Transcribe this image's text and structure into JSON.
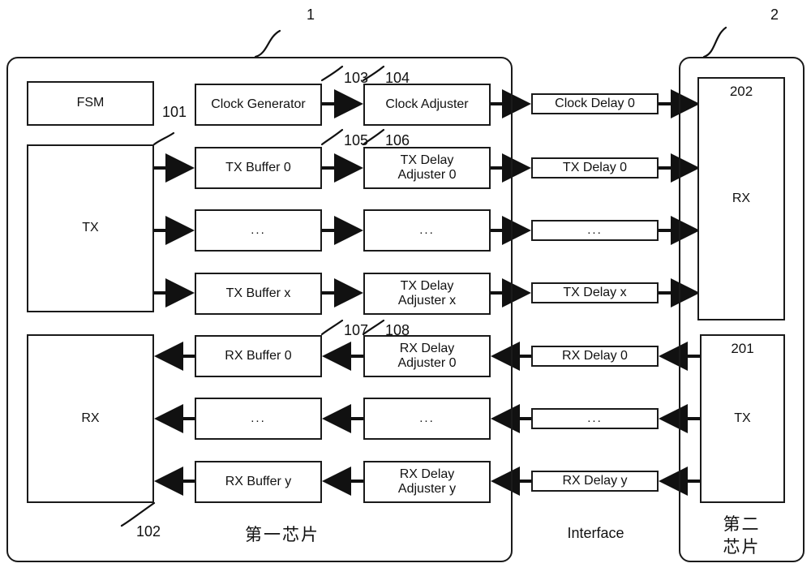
{
  "figure": {
    "refs": {
      "chip1": "1",
      "chip2": "2",
      "tx_core": "101",
      "rx_core": "102",
      "clock_generator": "103",
      "clock_adjuster": "104",
      "tx_buffer": "105",
      "tx_delay_adjuster": "106",
      "rx_buffer": "107",
      "rx_delay_adjuster": "108",
      "chip2_tx": "201",
      "chip2_rx": "202"
    },
    "captions": {
      "chip1": "第一芯片",
      "interface": "Interface",
      "chip2_line1": "第二",
      "chip2_line2": "芯片"
    }
  },
  "chip1": {
    "fsm": "FSM",
    "tx_core": "TX",
    "rx_core": "RX",
    "clock_generator": "Clock Generator",
    "clock_adjuster": "Clock Adjuster",
    "tx_buffers": [
      "TX Buffer 0",
      "...",
      "TX Buffer x"
    ],
    "tx_adjusters": [
      "TX Delay\nAdjuster 0",
      "...",
      "TX Delay\nAdjuster x"
    ],
    "rx_buffers": [
      "RX Buffer 0",
      "...",
      "RX Buffer y"
    ],
    "rx_adjusters": [
      "RX Delay\nAdjuster 0",
      "...",
      "RX Delay\nAdjuster y"
    ]
  },
  "interface": {
    "clock_delay": "Clock Delay 0",
    "tx_delays": [
      "TX Delay 0",
      "...",
      "TX Delay x"
    ],
    "rx_delays": [
      "RX Delay 0",
      "...",
      "RX Delay y"
    ]
  },
  "chip2": {
    "rx": "RX",
    "tx": "TX"
  },
  "colors": {
    "stroke": "#1a1a1a",
    "background": "#ffffff",
    "text": "#111111"
  }
}
